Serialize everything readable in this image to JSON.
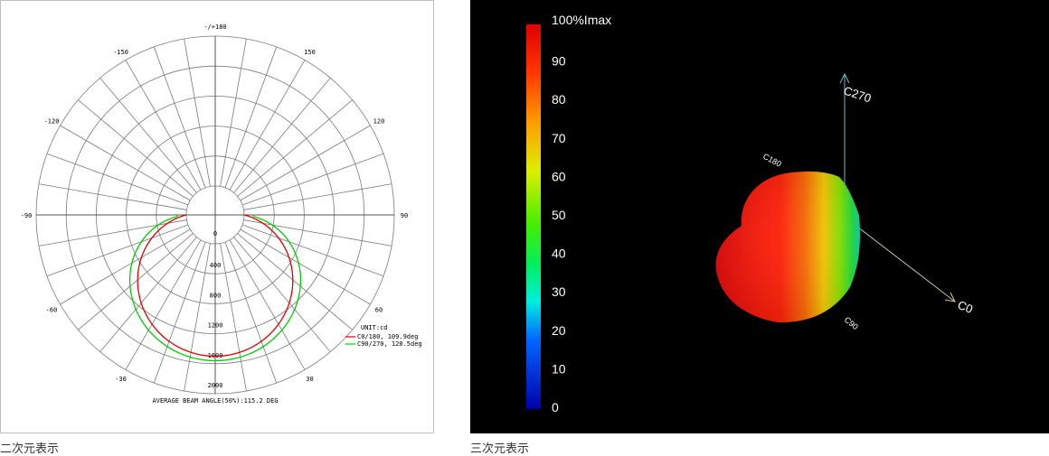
{
  "captions": {
    "two_d": "二次元表示",
    "three_d": "三次元表示"
  },
  "chart_data": [
    {
      "type": "polar",
      "angle_labels": [
        {
          "text": "-/+180",
          "angle": 180
        },
        {
          "text": "-150",
          "angle": -150
        },
        {
          "text": "150",
          "angle": 150
        },
        {
          "text": "-120",
          "angle": -120
        },
        {
          "text": "120",
          "angle": 120
        },
        {
          "text": "-90",
          "angle": -90
        },
        {
          "text": "90",
          "angle": 90
        },
        {
          "text": "-60",
          "angle": -60
        },
        {
          "text": "60",
          "angle": 60
        },
        {
          "text": "-30",
          "angle": -30
        },
        {
          "text": "30",
          "angle": 30
        }
      ],
      "radial_ticks": [
        "0",
        "400",
        "800",
        "1200",
        "1600",
        "2000"
      ],
      "radial_max": 2000,
      "unit_label": "UNIT:cd",
      "series": [
        {
          "name": "C0/180, 109.9deg",
          "color": "#e00000",
          "peak": 1500,
          "shape": 1.0
        },
        {
          "name": "C90/270, 120.5deg",
          "color": "#00cc00",
          "peak": 1560,
          "shape": 0.8
        }
      ],
      "beam_label": "AVERAGE BEAM ANGLE(50%):115.2 DEG"
    },
    {
      "type": "3d-intensity",
      "colorbar_labels": [
        "100%Imax",
        "90",
        "80",
        "70",
        "60",
        "50",
        "40",
        "30",
        "20",
        "10",
        "0"
      ],
      "axis_labels": {
        "c0": "C0",
        "c270": "C270",
        "c180": "C180",
        "c90": "C90"
      }
    }
  ]
}
